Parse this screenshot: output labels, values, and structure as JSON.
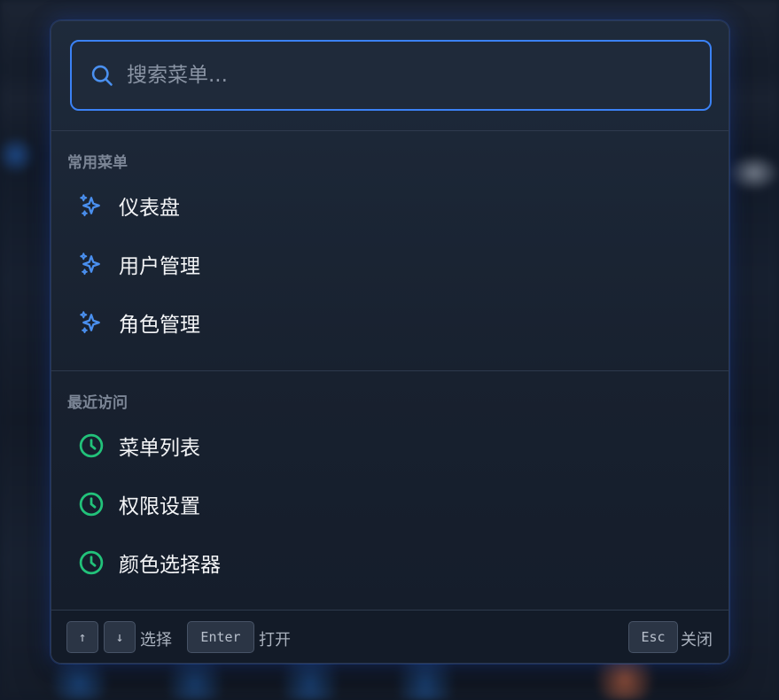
{
  "search": {
    "placeholder": "搜索菜单..."
  },
  "sections": [
    {
      "title": "常用菜单",
      "icon": "sparkles-icon",
      "icon_color": "#4a90f0",
      "items": [
        {
          "label": "仪表盘"
        },
        {
          "label": "用户管理"
        },
        {
          "label": "角色管理"
        }
      ]
    },
    {
      "title": "最近访问",
      "icon": "clock-icon",
      "icon_color": "#22c27a",
      "items": [
        {
          "label": "菜单列表"
        },
        {
          "label": "权限设置"
        },
        {
          "label": "颜色选择器"
        }
      ]
    }
  ],
  "footer": {
    "up_key": "↑",
    "down_key": "↓",
    "select_label": "选择",
    "enter_key": "Enter",
    "open_label": "打开",
    "esc_key": "Esc",
    "close_label": "关闭"
  },
  "colors": {
    "accent": "#3b82f6",
    "favorite_icon": "#4a90f0",
    "recent_icon": "#22c27a"
  }
}
